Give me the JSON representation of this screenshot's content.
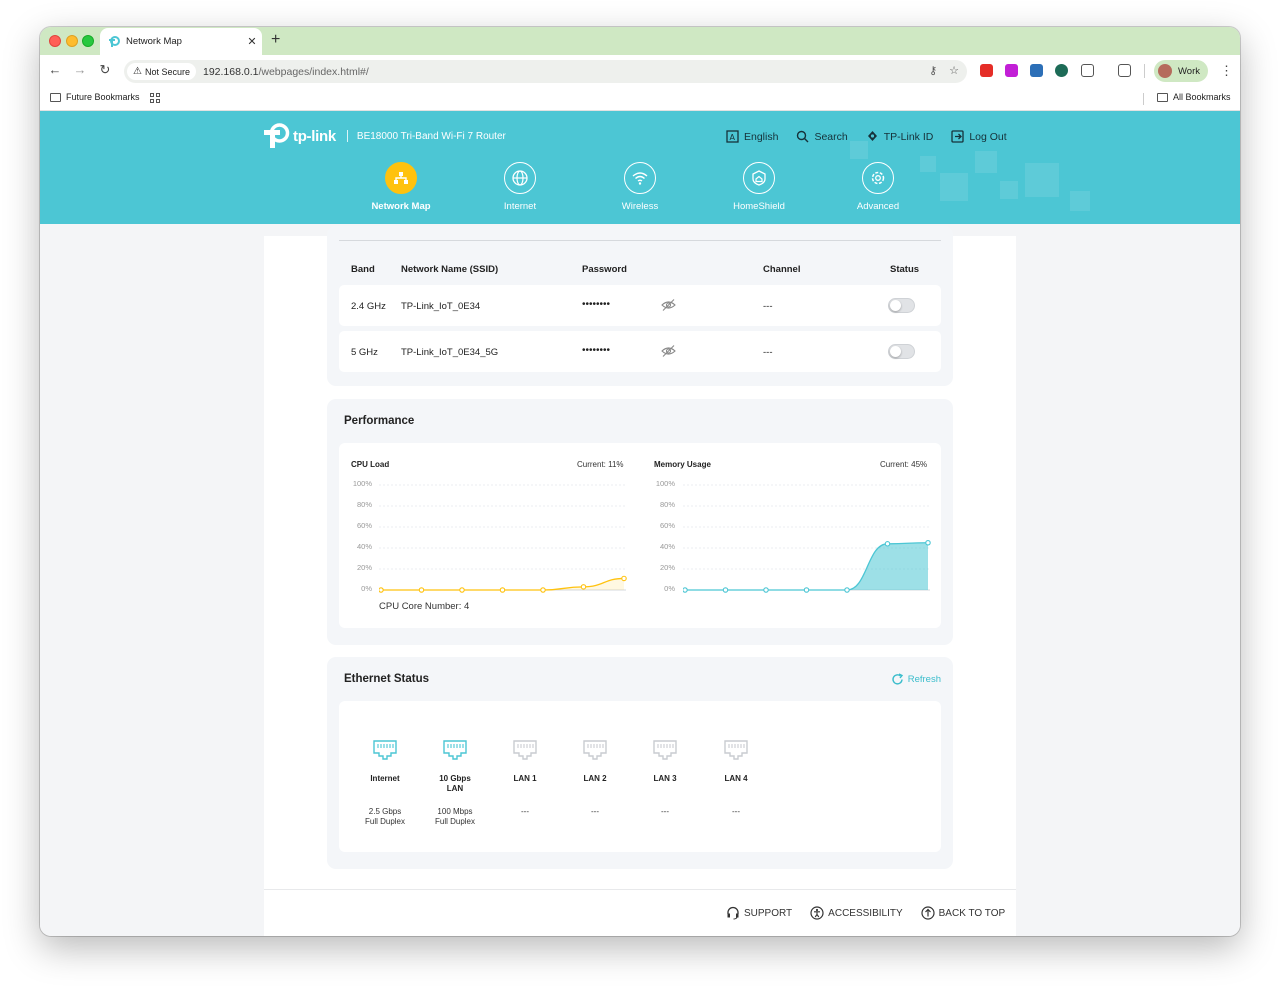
{
  "browser": {
    "tab_title": "Network Map",
    "new_tab": "+",
    "tab_close": "✕",
    "not_secure": "Not Secure",
    "url_host": "192.168.0.1",
    "url_path": "/webpages/index.html#/",
    "profile_name": "Work",
    "bookmarks": {
      "folder": "Future Bookmarks",
      "all": "All Bookmarks"
    }
  },
  "router": {
    "brand": "tp-link",
    "model": "BE18000 Tri-Band Wi-Fi 7 Router",
    "header_links": {
      "language": "English",
      "search": "Search",
      "tplink_id": "TP-Link ID",
      "logout": "Log Out"
    },
    "nav": {
      "network_map": "Network Map",
      "internet": "Internet",
      "wireless": "Wireless",
      "homeshield": "HomeShield",
      "advanced": "Advanced"
    },
    "accent_color": "#4cc6d4",
    "active_color": "#ffc20e"
  },
  "wifi_table": {
    "headers": {
      "band": "Band",
      "ssid": "Network Name (SSID)",
      "password": "Password",
      "channel": "Channel",
      "status": "Status"
    },
    "rows": [
      {
        "band": "2.4 GHz",
        "ssid": "TP-Link_IoT_0E34",
        "password": "••••••••",
        "channel": "---",
        "enabled": false
      },
      {
        "band": "5 GHz",
        "ssid": "TP-Link_IoT_0E34_5G",
        "password": "••••••••",
        "channel": "---",
        "enabled": false
      }
    ]
  },
  "performance": {
    "title": "Performance",
    "cpu": {
      "title": "CPU Load",
      "current": "Current: 11%",
      "core_number": "CPU Core Number: 4"
    },
    "memory": {
      "title": "Memory Usage",
      "current": "Current: 45%"
    },
    "y_ticks": [
      "100%",
      "80%",
      "60%",
      "40%",
      "20%",
      "0%"
    ]
  },
  "chart_data": [
    {
      "type": "line",
      "title": "CPU Load",
      "x": [
        1,
        2,
        3,
        4,
        5,
        6,
        7
      ],
      "series": [
        {
          "values": [
            0,
            0,
            0,
            0,
            0,
            3,
            11
          ]
        }
      ],
      "ylim": [
        0,
        100
      ],
      "grid": true,
      "color": "#ffc20e"
    },
    {
      "type": "area",
      "title": "Memory Usage",
      "x": [
        1,
        2,
        3,
        4,
        5,
        6,
        7
      ],
      "series": [
        {
          "values": [
            0,
            0,
            0,
            0,
            0,
            44,
            45
          ]
        }
      ],
      "ylim": [
        0,
        100
      ],
      "grid": true,
      "color": "#4cc6d4"
    }
  ],
  "ethernet": {
    "title": "Ethernet Status",
    "refresh": "Refresh",
    "ports": [
      {
        "name": "Internet",
        "speed": "2.5 Gbps\nFull Duplex",
        "connected": true
      },
      {
        "name": "10 Gbps\nLAN",
        "speed": "100 Mbps\nFull Duplex",
        "connected": true
      },
      {
        "name": "LAN 1",
        "speed": "---",
        "connected": false
      },
      {
        "name": "LAN 2",
        "speed": "---",
        "connected": false
      },
      {
        "name": "LAN 3",
        "speed": "---",
        "connected": false
      },
      {
        "name": "LAN 4",
        "speed": "---",
        "connected": false
      }
    ]
  },
  "footer": {
    "support": "SUPPORT",
    "accessibility": "ACCESSIBILITY",
    "back_to_top": "BACK TO TOP"
  }
}
